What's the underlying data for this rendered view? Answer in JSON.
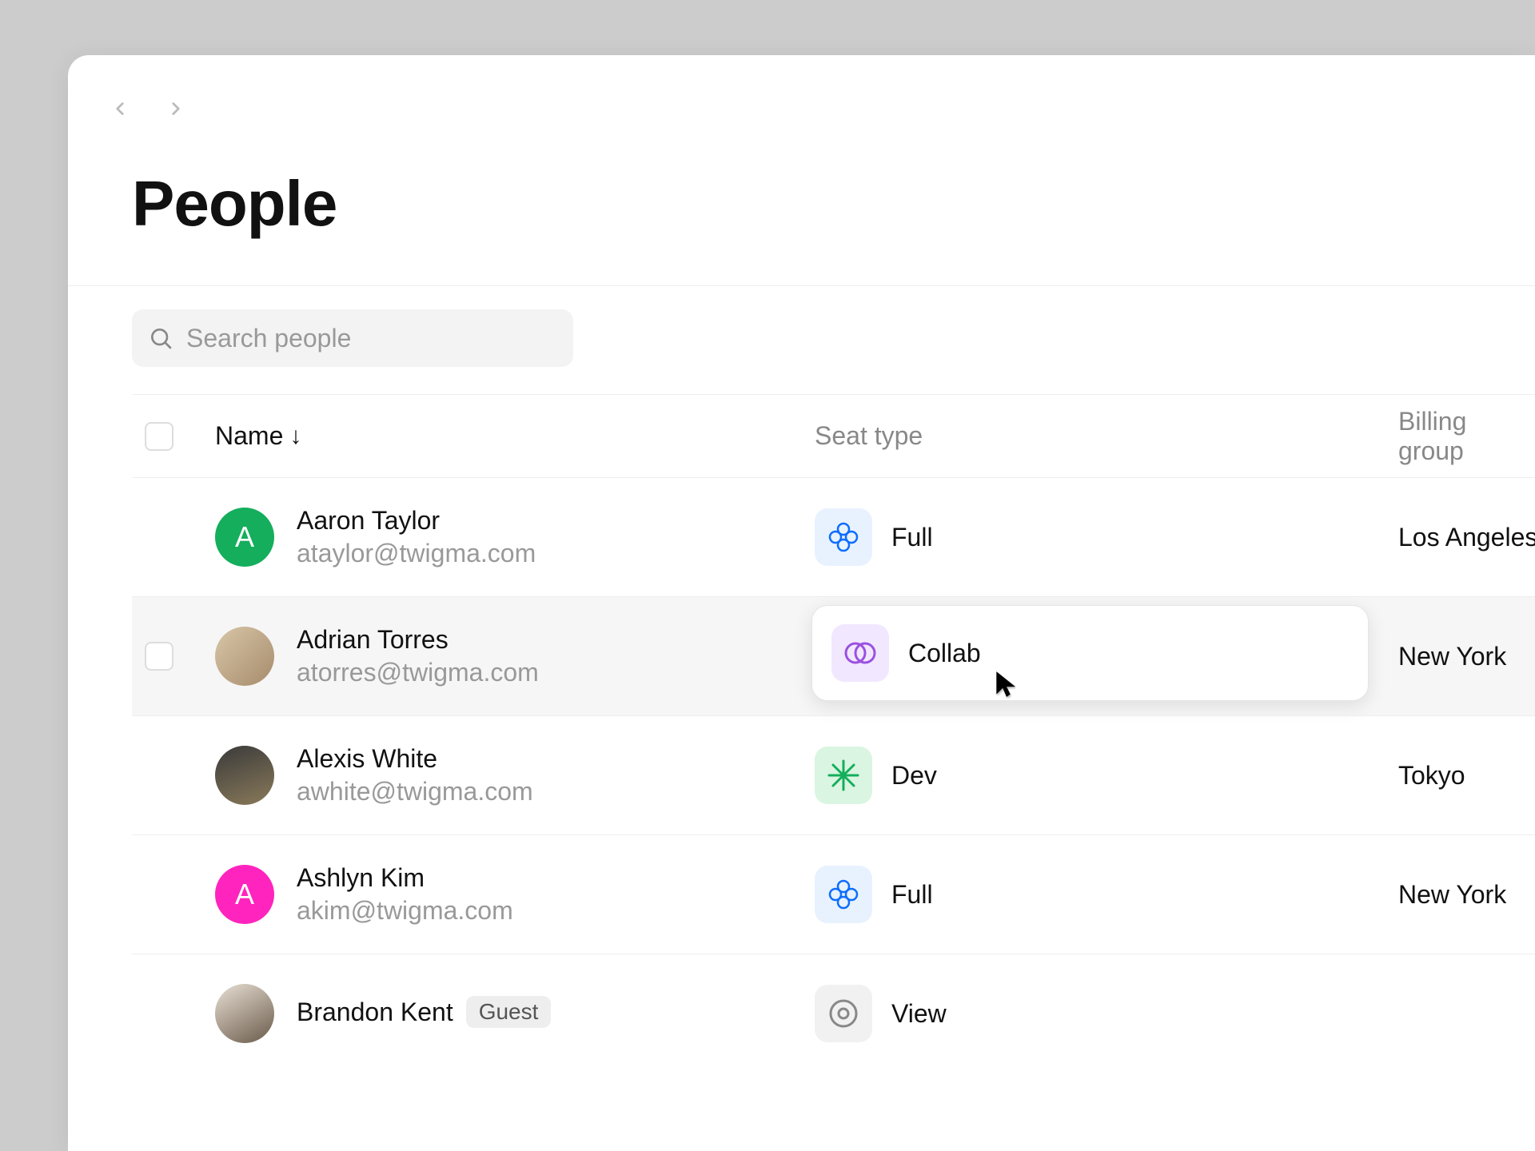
{
  "page": {
    "title": "People"
  },
  "search": {
    "placeholder": "Search people"
  },
  "columns": {
    "name": "Name",
    "sort_indicator": "↓",
    "seat_type": "Seat type",
    "billing_group": "Billing group"
  },
  "seat_labels": {
    "full": "Full",
    "collab": "Collab",
    "dev": "Dev",
    "view": "View"
  },
  "badges": {
    "guest": "Guest"
  },
  "people": [
    {
      "name": "Aaron Taylor",
      "email": "ataylor@twigma.com",
      "avatar_initial": "A",
      "seat": "full",
      "billing": "Los Angeles"
    },
    {
      "name": "Adrian Torres",
      "email": "atorres@twigma.com",
      "avatar_initial": "",
      "seat": "collab",
      "billing": "New York"
    },
    {
      "name": "Alexis White",
      "email": "awhite@twigma.com",
      "avatar_initial": "",
      "seat": "dev",
      "billing": "Tokyo"
    },
    {
      "name": "Ashlyn Kim",
      "email": "akim@twigma.com",
      "avatar_initial": "A",
      "seat": "full",
      "billing": "New York"
    },
    {
      "name": "Brandon Kent",
      "email": "",
      "avatar_initial": "",
      "seat": "view",
      "billing": "",
      "guest": true
    }
  ]
}
